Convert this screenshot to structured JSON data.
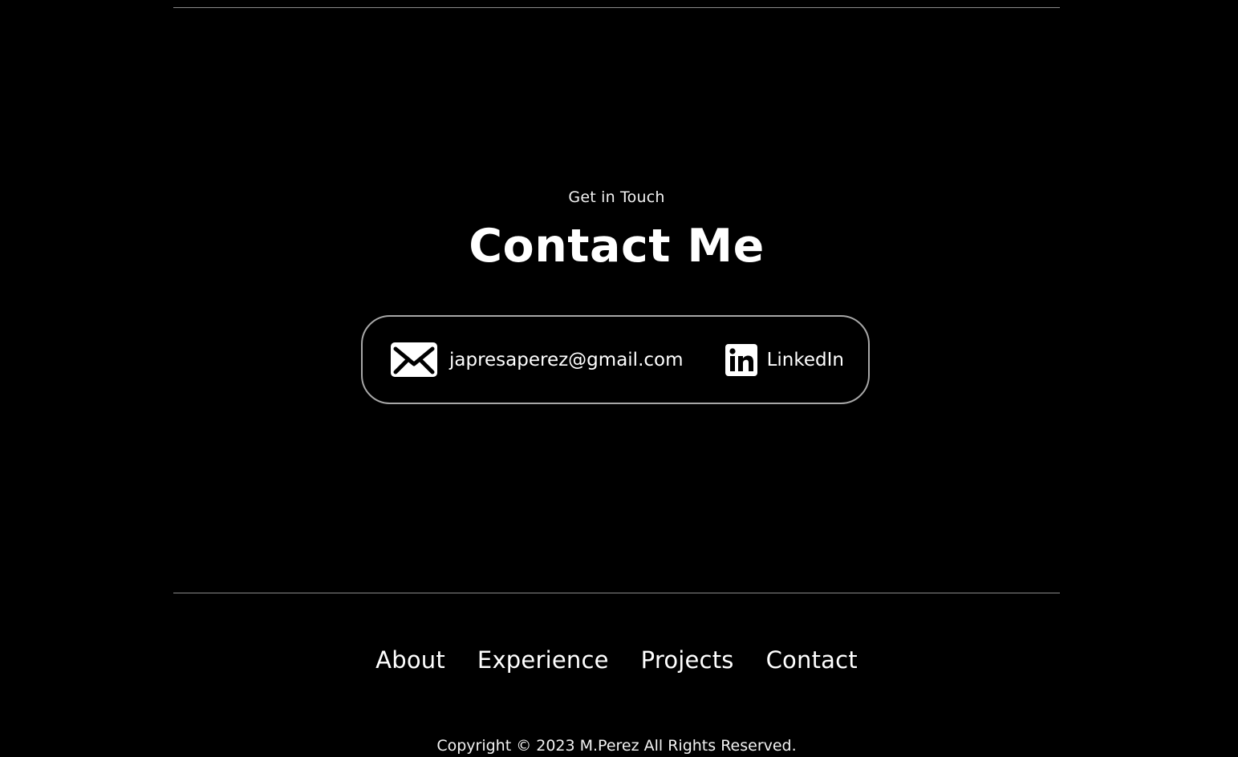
{
  "contact_section": {
    "subtitle": "Get in Touch",
    "title": "Contact Me",
    "email": {
      "icon": "mail-icon",
      "label": "japresaperez@gmail.com"
    },
    "linkedin": {
      "icon": "linkedin-icon",
      "label": "LinkedIn"
    }
  },
  "footer": {
    "nav": [
      {
        "label": "About"
      },
      {
        "label": "Experience"
      },
      {
        "label": "Projects"
      },
      {
        "label": "Contact"
      }
    ],
    "copyright": "Copyright © 2023 M.Perez All Rights Reserved."
  },
  "colors": {
    "background": "#000000",
    "text": "#ffffff",
    "border": "#a7a7a7",
    "divider": "#8a8a8a"
  }
}
